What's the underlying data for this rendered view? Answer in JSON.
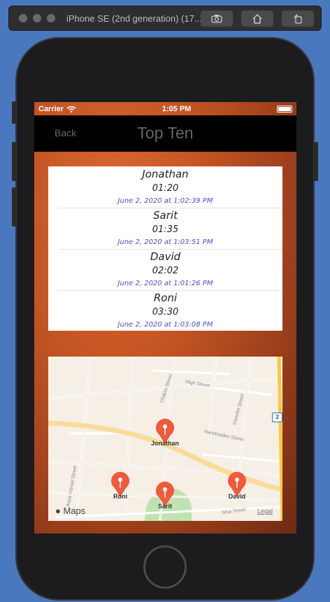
{
  "simulator": {
    "title": "iPhone SE (2nd generation) (17..."
  },
  "status_bar": {
    "carrier": "Carrier",
    "time": "1:05 PM"
  },
  "nav": {
    "back_label": "Back",
    "title": "Top Ten"
  },
  "scores": [
    {
      "name": "Jonathan",
      "time": "01:20",
      "date": "June 2, 2020 at 1:02:39 PM"
    },
    {
      "name": "Sarit",
      "time": "01:35",
      "date": "June 2, 2020 at 1:03:51 PM"
    },
    {
      "name": "David",
      "time": "02:02",
      "date": "June 2, 2020 at 1:01:26 PM"
    },
    {
      "name": "Roni",
      "time": "03:30",
      "date": "June 2, 2020 at 1:03:08 PM"
    }
  ],
  "map": {
    "logo": "Maps",
    "legal": "Legal",
    "route_badge": "2",
    "pins": [
      "Jonathan",
      "Roni",
      "Sarit",
      "David"
    ],
    "streets": [
      "Ofakim Street",
      "High Street",
      "Hanofet Street",
      "Hamitnadev Street",
      "Anya Visrael Street",
      "Shai Street"
    ]
  },
  "colors": {
    "accent_date": "#4b4bd6",
    "pin": "#ef5a3c",
    "background_orange": "#c45524"
  }
}
